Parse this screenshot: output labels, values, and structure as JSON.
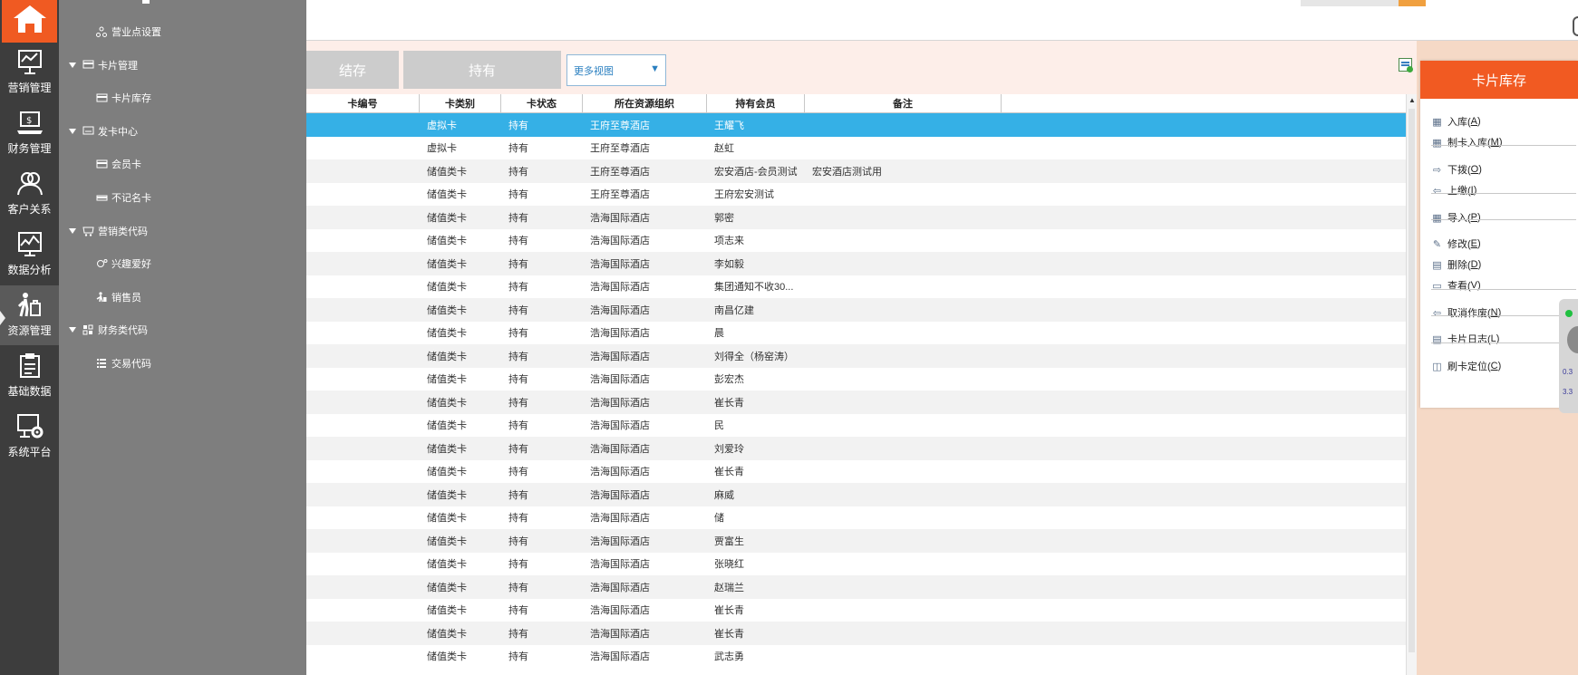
{
  "sidebar": {
    "items": [
      {
        "label": "营销管理",
        "icon": "marketing-board-icon"
      },
      {
        "label": "财务管理",
        "icon": "finance-laptop-icon"
      },
      {
        "label": "客户关系",
        "icon": "customers-icon"
      },
      {
        "label": "数据分析",
        "icon": "data-chart-icon"
      },
      {
        "label": "资源管理",
        "icon": "resource-person-icon",
        "active": true
      },
      {
        "label": "基础数据",
        "icon": "clipboard-icon"
      },
      {
        "label": "系统平台",
        "icon": "system-gear-icon"
      }
    ]
  },
  "tree": {
    "items": [
      {
        "label": "营业点设置",
        "level": 2,
        "icon": "network-icon"
      },
      {
        "label": "卡片管理",
        "level": 1,
        "icon": "card-folder-icon"
      },
      {
        "label": "卡片库存",
        "level": 2,
        "icon": "card-stock-icon"
      },
      {
        "label": "发卡中心",
        "level": 1,
        "icon": "card-center-icon"
      },
      {
        "label": "会员卡",
        "level": 2,
        "icon": "member-card-icon"
      },
      {
        "label": "不记名卡",
        "level": 2,
        "icon": "anonymous-card-icon"
      },
      {
        "label": "营销类代码",
        "level": 1,
        "icon": "marketing-code-icon"
      },
      {
        "label": "兴趣爱好",
        "level": 2,
        "icon": "hobby-icon"
      },
      {
        "label": "销售员",
        "level": 2,
        "icon": "salesman-icon"
      },
      {
        "label": "财务类代码",
        "level": 1,
        "icon": "finance-code-icon"
      },
      {
        "label": "交易代码",
        "level": 2,
        "icon": "transaction-list-icon"
      }
    ]
  },
  "toolbar": {
    "tabs": [
      {
        "label": "结存"
      },
      {
        "label": "持有"
      }
    ],
    "view_select": {
      "value": "更多视图"
    }
  },
  "table": {
    "columns": [
      "卡编号",
      "卡类别",
      "卡状态",
      "所在资源组织",
      "持有会员",
      "备注"
    ],
    "rows": [
      {
        "type": "虚拟卡",
        "status": "持有",
        "org": "王府至尊酒店",
        "member": "王耀飞",
        "note": ""
      },
      {
        "type": "虚拟卡",
        "status": "持有",
        "org": "王府至尊酒店",
        "member": "赵虹",
        "note": ""
      },
      {
        "type": "储值类卡",
        "status": "持有",
        "org": "王府至尊酒店",
        "member": "宏安酒店-会员测试",
        "note": "宏安酒店测试用"
      },
      {
        "type": "储值类卡",
        "status": "持有",
        "org": "王府至尊酒店",
        "member": "王府宏安测试",
        "note": ""
      },
      {
        "type": "储值类卡",
        "status": "持有",
        "org": "浩海国际酒店",
        "member": "郭密",
        "note": ""
      },
      {
        "type": "储值类卡",
        "status": "持有",
        "org": "浩海国际酒店",
        "member": "项志来",
        "note": ""
      },
      {
        "type": "储值类卡",
        "status": "持有",
        "org": "浩海国际酒店",
        "member": "李如毅",
        "note": ""
      },
      {
        "type": "储值类卡",
        "status": "持有",
        "org": "浩海国际酒店",
        "member": "集团通知不收30...",
        "note": ""
      },
      {
        "type": "储值类卡",
        "status": "持有",
        "org": "浩海国际酒店",
        "member": "南昌亿建",
        "note": ""
      },
      {
        "type": "储值类卡",
        "status": "持有",
        "org": "浩海国际酒店",
        "member": "晨",
        "note": ""
      },
      {
        "type": "储值类卡",
        "status": "持有",
        "org": "浩海国际酒店",
        "member": "刘得全（杨窑涛）",
        "note": ""
      },
      {
        "type": "储值类卡",
        "status": "持有",
        "org": "浩海国际酒店",
        "member": "彭宏杰",
        "note": ""
      },
      {
        "type": "储值类卡",
        "status": "持有",
        "org": "浩海国际酒店",
        "member": "崔长青",
        "note": ""
      },
      {
        "type": "储值类卡",
        "status": "持有",
        "org": "浩海国际酒店",
        "member": "民",
        "note": ""
      },
      {
        "type": "储值类卡",
        "status": "持有",
        "org": "浩海国际酒店",
        "member": "刘爱玲",
        "note": ""
      },
      {
        "type": "储值类卡",
        "status": "持有",
        "org": "浩海国际酒店",
        "member": "崔长青",
        "note": ""
      },
      {
        "type": "储值类卡",
        "status": "持有",
        "org": "浩海国际酒店",
        "member": "麻威",
        "note": ""
      },
      {
        "type": "储值类卡",
        "status": "持有",
        "org": "浩海国际酒店",
        "member": "储",
        "note": ""
      },
      {
        "type": "储值类卡",
        "status": "持有",
        "org": "浩海国际酒店",
        "member": "贾富生",
        "note": ""
      },
      {
        "type": "储值类卡",
        "status": "持有",
        "org": "浩海国际酒店",
        "member": "张晓红",
        "note": ""
      },
      {
        "type": "储值类卡",
        "status": "持有",
        "org": "浩海国际酒店",
        "member": "赵瑞兰",
        "note": ""
      },
      {
        "type": "储值类卡",
        "status": "持有",
        "org": "浩海国际酒店",
        "member": "崔长青",
        "note": ""
      },
      {
        "type": "储值类卡",
        "status": "持有",
        "org": "浩海国际酒店",
        "member": "崔长青",
        "note": ""
      },
      {
        "type": "储值类卡",
        "status": "持有",
        "org": "浩海国际酒店",
        "member": "武志勇",
        "note": ""
      }
    ]
  },
  "actions": {
    "title": "卡片库存",
    "items": [
      {
        "text": "入库(",
        "key": "A",
        "end": ")",
        "icon": "stock-in-icon"
      },
      {
        "text": "制卡入库(",
        "key": "M",
        "end": ")",
        "icon": "make-card-icon"
      },
      {
        "text": "下拨(",
        "key": "O",
        "end": ")",
        "icon": "allocate-arrow-icon"
      },
      {
        "text": "上缴(",
        "key": "I",
        "end": ")",
        "icon": "return-arrow-icon"
      },
      {
        "text": "导入(",
        "key": "P",
        "end": ")",
        "icon": "import-icon"
      },
      {
        "text": "修改(",
        "key": "E",
        "end": ")",
        "icon": "edit-icon"
      },
      {
        "text": "删除(",
        "key": "D",
        "end": ")",
        "icon": "delete-icon"
      },
      {
        "text": "查看(",
        "key": "V",
        "end": ")",
        "icon": "view-monitor-icon"
      },
      {
        "text": "取消作废(",
        "key": "N",
        "end": ")",
        "icon": "cancel-void-icon"
      },
      {
        "text": "卡片日志(",
        "key": "L",
        "end": ")",
        "icon": "log-document-icon"
      },
      {
        "text": "刷卡定位(",
        "key": "C",
        "end": ")",
        "icon": "swipe-card-icon"
      }
    ]
  },
  "widget": {
    "line1": "0.3",
    "line2": "3.3"
  },
  "colors": {
    "accent": "#f15a22",
    "selected_row": "#35b0e6",
    "sidebar": "#3d3d3d",
    "tree": "#7e7e7e"
  }
}
